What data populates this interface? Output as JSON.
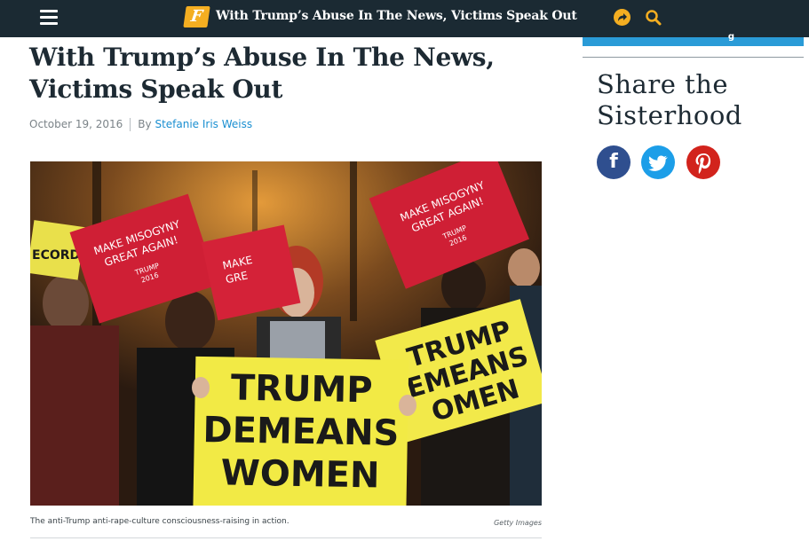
{
  "topbar": {
    "title": "With Trump’s Abuse In The News, Victims Speak Out",
    "logo_letter": "F",
    "colors": {
      "background": "#1b2a33",
      "accent": "#f4ae21"
    },
    "icons": [
      "menu-icon",
      "share-icon",
      "search-icon"
    ]
  },
  "article": {
    "headline_line1": "With Trump’s Abuse In The News,",
    "headline_line2": "Victims Speak Out",
    "date": "October 19, 2016",
    "by_label": "By",
    "author": "Stefanie Iris Weiss",
    "caption": "The anti-Trump anti-rape-culture consciousness-raising in action.",
    "credit": "Getty Images"
  },
  "photo_signs": {
    "yellow_front": [
      "TRUMP",
      "DEMEANS",
      "WOMEN"
    ],
    "yellow_right": [
      "TRUMP",
      "EMEANS",
      "OMEN"
    ],
    "red_left": [
      "MAKE MISOGYNY",
      "GREAT AGAIN!",
      "TRUMP",
      "2016"
    ],
    "red_right": [
      "MAKE MISOGYNY",
      "GREAT AGAIN!",
      "TRUMP",
      "2016"
    ],
    "red_mid": [
      "MAKE",
      "GRE"
    ]
  },
  "sidebar": {
    "top_fragment": "g",
    "share_heading_line1": "Share the",
    "share_heading_line2": "Sisterhood",
    "social": {
      "facebook": "f",
      "twitter": "t",
      "pinterest": "p"
    },
    "colors": {
      "facebook": "#2f4f8f",
      "twitter": "#1c9ee8",
      "pinterest": "#d2231c",
      "bar": "#2a9bd7"
    }
  }
}
